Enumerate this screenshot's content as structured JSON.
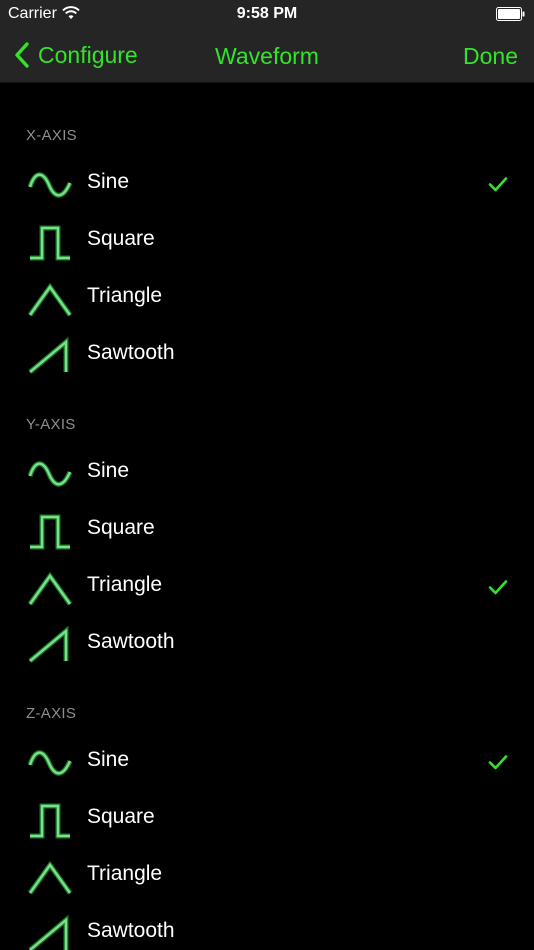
{
  "status_bar": {
    "carrier": "Carrier",
    "time": "9:58 PM"
  },
  "nav": {
    "back_label": "Configure",
    "title": "Waveform",
    "done_label": "Done"
  },
  "colors": {
    "accent": "#33e32a",
    "wave_stroke": "#7be08a",
    "background": "#000000",
    "bar": "#252525",
    "header_text": "#8e8e8e"
  },
  "sections": [
    {
      "header": "X-AXIS",
      "options": [
        {
          "label": "Sine",
          "icon": "sine-wave-icon",
          "selected": true
        },
        {
          "label": "Square",
          "icon": "square-wave-icon",
          "selected": false
        },
        {
          "label": "Triangle",
          "icon": "triangle-wave-icon",
          "selected": false
        },
        {
          "label": "Sawtooth",
          "icon": "sawtooth-wave-icon",
          "selected": false
        }
      ]
    },
    {
      "header": "Y-AXIS",
      "options": [
        {
          "label": "Sine",
          "icon": "sine-wave-icon",
          "selected": false
        },
        {
          "label": "Square",
          "icon": "square-wave-icon",
          "selected": false
        },
        {
          "label": "Triangle",
          "icon": "triangle-wave-icon",
          "selected": true
        },
        {
          "label": "Sawtooth",
          "icon": "sawtooth-wave-icon",
          "selected": false
        }
      ]
    },
    {
      "header": "Z-AXIS",
      "options": [
        {
          "label": "Sine",
          "icon": "sine-wave-icon",
          "selected": true
        },
        {
          "label": "Square",
          "icon": "square-wave-icon",
          "selected": false
        },
        {
          "label": "Triangle",
          "icon": "triangle-wave-icon",
          "selected": false
        },
        {
          "label": "Sawtooth",
          "icon": "sawtooth-wave-icon",
          "selected": false
        }
      ]
    }
  ]
}
